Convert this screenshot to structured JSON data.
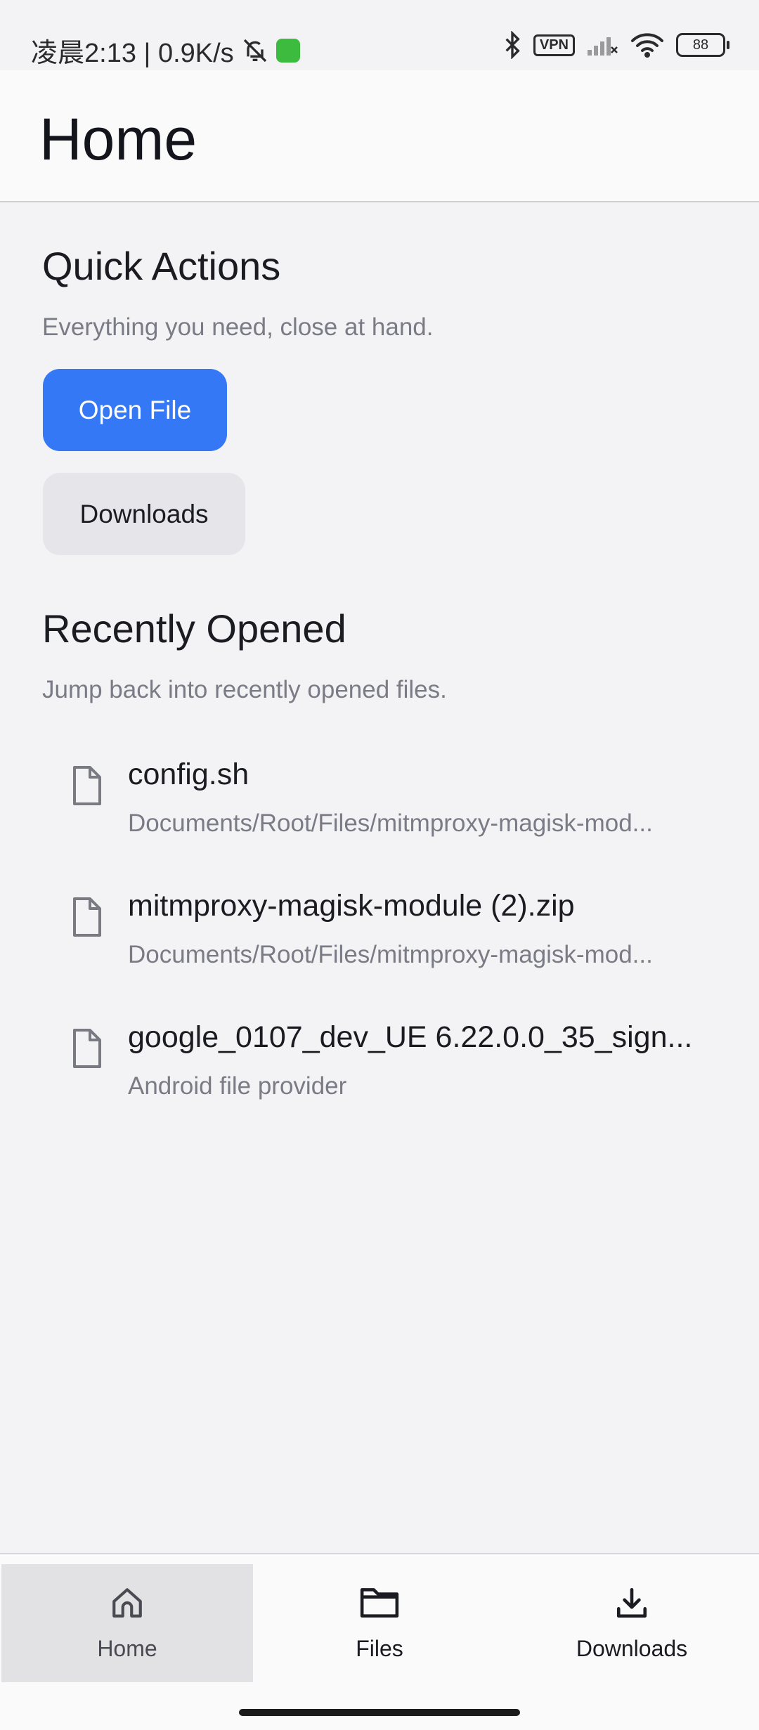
{
  "status_bar": {
    "time_text": "凌晨2:13 | 0.9K/s",
    "vpn_label": "VPN",
    "battery_level": "88"
  },
  "app_bar": {
    "title": "Home"
  },
  "quick_actions": {
    "title": "Quick Actions",
    "subtitle": "Everything you need, close at hand.",
    "open_file_label": "Open File",
    "downloads_label": "Downloads"
  },
  "recently_opened": {
    "title": "Recently Opened",
    "subtitle": "Jump back into recently opened files.",
    "items": [
      {
        "name": "config.sh",
        "path": "Documents/Root/Files/mitmproxy-magisk-mod...",
        "icon": "file-icon"
      },
      {
        "name": "mitmproxy-magisk-module (2).zip",
        "path": "Documents/Root/Files/mitmproxy-magisk-mod...",
        "icon": "file-icon"
      },
      {
        "name": "google_0107_dev_UE 6.22.0.0_35_sign...",
        "path": "Android file provider",
        "icon": "file-icon"
      }
    ]
  },
  "bottom_nav": {
    "items": [
      {
        "label": "Home",
        "icon": "home-icon",
        "active": true
      },
      {
        "label": "Files",
        "icon": "folder-icon",
        "active": false
      },
      {
        "label": "Downloads",
        "icon": "download-icon",
        "active": false
      }
    ]
  },
  "colors": {
    "accent": "#3478f6",
    "background": "#f3f3f6",
    "secondary_button": "#e6e6ea",
    "active_nav": "#e2e2e4"
  }
}
